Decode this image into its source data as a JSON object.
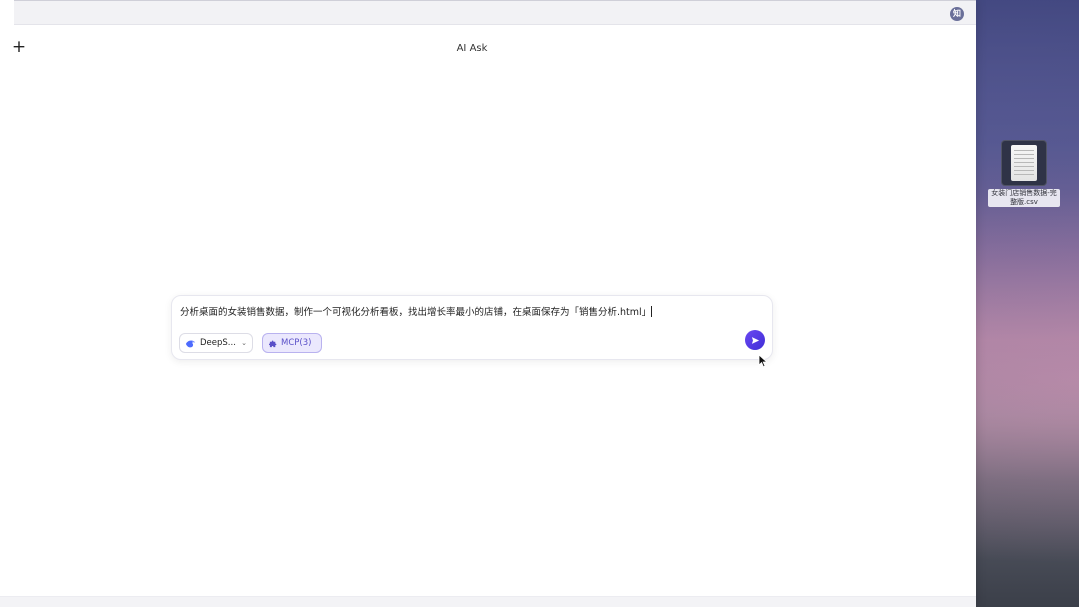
{
  "app": {
    "title": "AI Ask"
  },
  "toolbar": {
    "new_chat_label": "+"
  },
  "top_strip": {
    "icon_glyph": "知"
  },
  "composer": {
    "input_value": "分析桌面的女装销售数据，制作一个可视化分析看板，找出增长率最小的店铺，在桌面保存为「销售分析.html」",
    "model_label": "DeepS...",
    "mcp_label": "MCP(3)"
  },
  "desktop": {
    "file_name": "女装门店销售数据-完整版.csv"
  },
  "colors": {
    "accent": "#4f3ce0",
    "mcp_background": "#ebe8fd",
    "mcp_text": "#5a50c8"
  },
  "icons": {
    "new_chat": "plus-icon",
    "model": "deepseek-whale-icon",
    "mcp": "puzzle-icon",
    "send": "send-arrow-icon",
    "file": "csv-file-icon"
  }
}
